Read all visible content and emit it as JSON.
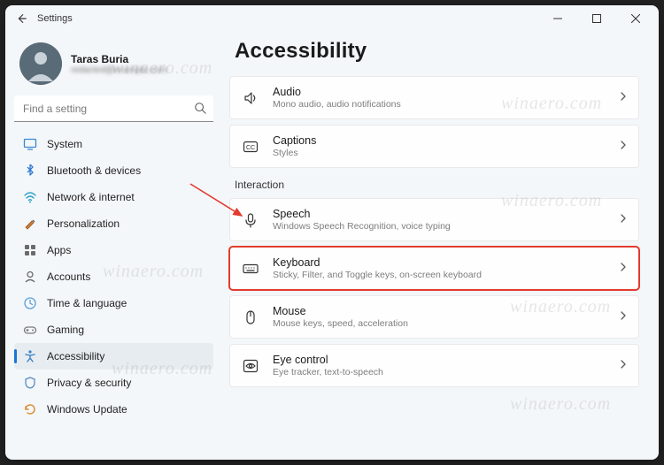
{
  "window": {
    "title": "Settings"
  },
  "profile": {
    "name": "Taras Buria",
    "email": "redacted@example.com"
  },
  "search": {
    "placeholder": "Find a setting"
  },
  "sidebar": {
    "items": [
      {
        "label": "System",
        "icon": "system"
      },
      {
        "label": "Bluetooth & devices",
        "icon": "bluetooth"
      },
      {
        "label": "Network & internet",
        "icon": "wifi"
      },
      {
        "label": "Personalization",
        "icon": "personalization"
      },
      {
        "label": "Apps",
        "icon": "apps"
      },
      {
        "label": "Accounts",
        "icon": "accounts"
      },
      {
        "label": "Time & language",
        "icon": "time"
      },
      {
        "label": "Gaming",
        "icon": "gaming"
      },
      {
        "label": "Accessibility",
        "icon": "accessibility",
        "active": true
      },
      {
        "label": "Privacy & security",
        "icon": "privacy"
      },
      {
        "label": "Windows Update",
        "icon": "update"
      }
    ]
  },
  "page": {
    "title": "Accessibility",
    "sections": [
      {
        "label": "",
        "cards": [
          {
            "title": "Audio",
            "desc": "Mono audio, audio notifications",
            "icon": "audio"
          },
          {
            "title": "Captions",
            "desc": "Styles",
            "icon": "captions"
          }
        ]
      },
      {
        "label": "Interaction",
        "cards": [
          {
            "title": "Speech",
            "desc": "Windows Speech Recognition, voice typing",
            "icon": "speech"
          },
          {
            "title": "Keyboard",
            "desc": "Sticky, Filter, and Toggle keys, on-screen keyboard",
            "icon": "keyboard",
            "highlight": true
          },
          {
            "title": "Mouse",
            "desc": "Mouse keys, speed, acceleration",
            "icon": "mouse"
          },
          {
            "title": "Eye control",
            "desc": "Eye tracker, text-to-speech",
            "icon": "eye"
          }
        ]
      }
    ]
  },
  "watermark": "winaero.com"
}
